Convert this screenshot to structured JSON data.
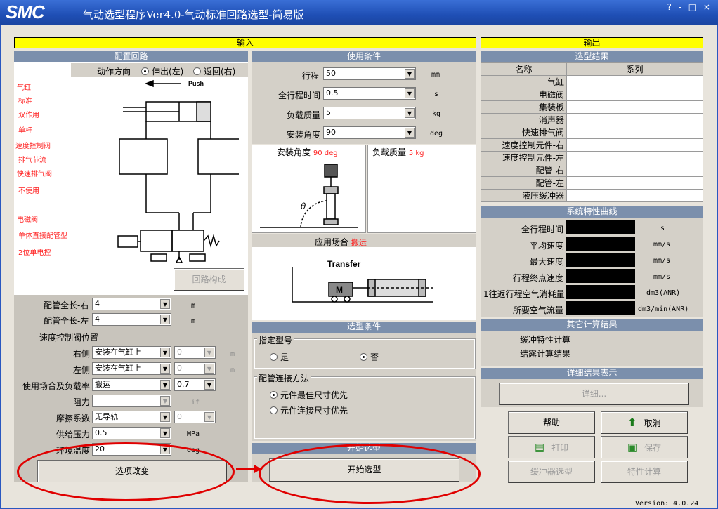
{
  "app": {
    "logo": "SMC",
    "title": "气动选型程序Ver4.0-气动标准回路选型-简易版",
    "window_controls": "? - □ ×",
    "version": "Version: 4.0.24"
  },
  "input_header": "输入",
  "output_header": "输出",
  "config": {
    "header": "配置回路",
    "direction_label": "动作方向",
    "dir_extend": "伸出(左)",
    "dir_return": "返回(右)",
    "push": "Push",
    "legend": [
      "气缸",
      "标准",
      "双作用",
      "单杆",
      "速度控制阀",
      "排气节流",
      "快速排气阀",
      "不使用",
      "电磁阀",
      "单体直接配管型",
      "2位单电控"
    ],
    "circuit_button": "回路构成"
  },
  "lower": {
    "pipe_right_label": "配管全长-右",
    "pipe_right": "4",
    "pipe_left_label": "配管全长-左",
    "pipe_left": "4",
    "unit_m": "m",
    "speed_valve_label": "速度控制阀位置",
    "right_label": "右侧",
    "right_value": "安装在气缸上",
    "right_sub": "0",
    "left_label": "左侧",
    "left_value": "安装在气缸上",
    "left_sub": "0",
    "usage_label": "使用场合及负载率",
    "usage_value": "搬运",
    "usage_rate": "0.7",
    "resistance_label": "阻力",
    "resistance_unit": "if",
    "friction_label": "摩擦系数",
    "friction_value": "无导轨",
    "friction_sub": "0",
    "pressure_label": "供给压力",
    "pressure_value": "0.5",
    "pressure_unit": "MPa",
    "temp_label": "环境温度",
    "temp_value": "20",
    "temp_unit": "deg",
    "mm_unit": "m",
    "options_button": "选项改变"
  },
  "usage": {
    "header": "使用条件",
    "stroke_label": "行程",
    "stroke": "50",
    "stroke_unit": "mm",
    "time_label": "全行程时间",
    "time": "0.5",
    "time_unit": "s",
    "load_label": "负载质量",
    "load": "5",
    "load_unit": "kg",
    "angle_label": "安装角度",
    "angle": "90",
    "angle_unit": "deg",
    "angle_panel_label": "安装角度",
    "angle_panel_value": "90 deg",
    "load_panel_label": "负载质量",
    "load_panel_value": "5 kg",
    "theta": "θ",
    "app_label": "应用场合",
    "app_value": "搬运",
    "transfer": "Transfer",
    "motor": "M"
  },
  "selection": {
    "header": "选型条件",
    "model_group": "指定型号",
    "yes": "是",
    "no": "否",
    "pipe_group": "配管连接方法",
    "pipe_opt1": "元件最佳尺寸优先",
    "pipe_opt2": "元件连接尺寸优先",
    "start_header": "开始选型",
    "start_button": "开始选型"
  },
  "results": {
    "header": "选型结果",
    "col_name": "名称",
    "col_series": "系列",
    "rows": [
      "气缸",
      "电磁阀",
      "集装板",
      "消声器",
      "快速排气阀",
      "速度控制元件-右",
      "速度控制元件-左",
      "配管-右",
      "配管-左",
      "液压缓冲器"
    ]
  },
  "curve": {
    "header": "系统特性曲线",
    "rows": [
      {
        "label": "全行程时间",
        "unit": "s"
      },
      {
        "label": "平均速度",
        "unit": "mm/s"
      },
      {
        "label": "最大速度",
        "unit": "mm/s"
      },
      {
        "label": "行程终点速度",
        "unit": "mm/s"
      },
      {
        "label": "1往返行程空气消耗量",
        "unit": "dm3(ANR)"
      },
      {
        "label": "所要空气流量",
        "unit": "dm3/min(ANR)"
      }
    ]
  },
  "other": {
    "header": "其它计算结果",
    "cushion": "缓冲特性计算",
    "condensation": "结露计算结果"
  },
  "detail": {
    "header": "详细结果表示",
    "button": "详细..."
  },
  "buttons": {
    "help": "帮助",
    "cancel": "取消",
    "print": "打印",
    "save": "保存",
    "shock": "缓冲器选型",
    "characteristics": "特性计算"
  }
}
